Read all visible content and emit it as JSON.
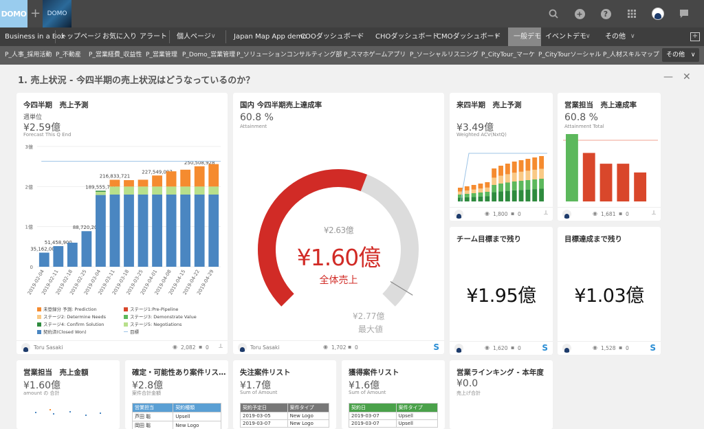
{
  "topbar": {
    "logo": "DOMO",
    "plus": "+",
    "logo2": "DOMO"
  },
  "nav1": {
    "items": [
      "Business in a Box",
      "トップページ",
      "お気に入り",
      "アラート",
      "個人ページ",
      "Japan Map App demo",
      "COOダッシュボード",
      "CHOダッシュボード",
      "CMOダッシュボード",
      "一般デモ",
      "イベントデモ",
      "その他"
    ]
  },
  "nav2": {
    "items": [
      "P_人事_採用活動",
      "P_不動産",
      "P_営業経費_収益性",
      "P_営業管理",
      "P_Domo_営業管理",
      "P_ソリューションコンサルティング部",
      "P_スマホゲームアプリ",
      "P_ソーシャルリスニング",
      "P_CityTour_マーケ",
      "P_CityTourソーシャル",
      "P_人材スキルマップ"
    ],
    "more": "その他"
  },
  "page": {
    "title": "1. 売上状況 - 今四半期の売上状況はどうなっているのか？",
    "minimize": "—",
    "close": "✕"
  },
  "colors": {
    "prediction": "#f58b2f",
    "pre_pipeline": "#d9472b",
    "determine": "#f9c985",
    "demonstrate": "#5cb85c",
    "confirm": "#2e8b3e",
    "negotiations": "#b8e08c",
    "closed": "#4a86c1",
    "target": "#9cc3e6",
    "gauge_fill": "#d12b26",
    "gauge_bg": "#dcdcdc",
    "salesforce": "#2a8dd4"
  },
  "forecast": {
    "title": "今四半期　売上予測",
    "subtitle": "週単位",
    "value": "¥2.59億",
    "caption": "Forecast This Q End",
    "footer": {
      "user": "Toru Sasaki",
      "views": "2,082",
      "comments": "0"
    },
    "legend": [
      "未登録分 予測: Prediction",
      "ステージ1:Pre-Pipeline",
      "ステージ2: Determine Needs",
      "ステージ3: Demonstrate Value",
      "ステージ4: Confirm Solution",
      "ステージ5: Negotiations",
      "契約済(Closed Won)",
      "目標"
    ]
  },
  "chart_data": {
    "type": "bar",
    "stacked": true,
    "categories": [
      "2019-02-04",
      "2019-02-11",
      "2019-02-18",
      "2019-02-25",
      "2019-03-04",
      "2019-03-11",
      "2019-03-18",
      "2019-03-25",
      "2019-04-01",
      "2019-04-08",
      "2019-04-15",
      "2019-04-22",
      "2019-04-29"
    ],
    "series": [
      {
        "name": "契約済(Closed Won)",
        "values": [
          35162000,
          51458900,
          60000000,
          88720200,
          179000000,
          180000000,
          180000000,
          180000000,
          180000000,
          180000000,
          180000000,
          180000000,
          180000000
        ]
      },
      {
        "name": "ステージ5: Negotiations",
        "values": [
          0,
          0,
          0,
          0,
          8000000,
          20000000,
          20000000,
          20000000,
          20000000,
          20000000,
          20000000,
          20000000,
          20000000
        ]
      },
      {
        "name": "ステージ4: Confirm Solution",
        "values": [
          0,
          0,
          0,
          0,
          2555721,
          0,
          0,
          0,
          0,
          0,
          0,
          0,
          0
        ]
      },
      {
        "name": "ステージ3: Demonstrate Value",
        "values": [
          0,
          0,
          0,
          0,
          0,
          0,
          0,
          0,
          0,
          0,
          0,
          0,
          0
        ]
      },
      {
        "name": "ステージ2: Determine Needs",
        "values": [
          0,
          0,
          0,
          0,
          0,
          0,
          0,
          0,
          0,
          0,
          0,
          0,
          0
        ]
      },
      {
        "name": "ステージ1:Pre-Pipeline",
        "values": [
          0,
          0,
          0,
          0,
          0,
          0,
          0,
          0,
          0,
          0,
          0,
          0,
          0
        ]
      },
      {
        "name": "未登録分 予測: Prediction",
        "values": [
          0,
          0,
          0,
          0,
          0,
          16833721,
          16000000,
          17000000,
          27549097,
          38000000,
          42000000,
          50508928,
          56000000
        ]
      }
    ],
    "target": {
      "name": "目標",
      "value": 263000000
    },
    "data_labels": [
      "35,162,000",
      "51,458,900",
      "",
      "88,720,200",
      "189,555,721",
      "216,833,721",
      "",
      "",
      "227,549,097",
      "",
      "",
      "250,508,928",
      ""
    ],
    "y_ticks": [
      "0",
      "1億",
      "2億",
      "3億"
    ],
    "ylim": [
      0,
      300000000
    ]
  },
  "gauge": {
    "title": "国内 今四半期売上達成率",
    "value": "60.8 %",
    "caption": "Attainment",
    "target_label": "¥2.63億",
    "center_value": "¥1.60億",
    "center_label": "全体売上",
    "max_value": "¥2.77億",
    "max_label": "最大値",
    "fraction": 0.578,
    "target_fraction": 0.95,
    "footer": {
      "user": "Toru Sasaki",
      "views": "1,702",
      "comments": "0"
    }
  },
  "next_q": {
    "title": "来四半期　売上予測",
    "value": "¥3.49億",
    "caption": "Weighted ACV(NxtQ)",
    "footer": {
      "views": "1,800",
      "comments": "0"
    }
  },
  "rep_attain": {
    "title": "営業担当　売上達成率",
    "value": "60.8 %",
    "caption": "Attainment Total",
    "bars": [
      100,
      72,
      56,
      56,
      43
    ],
    "footer": {
      "views": "1,681",
      "comments": "0"
    }
  },
  "team_remain": {
    "title": "チーム目標まで残り",
    "value": "¥1.95億",
    "footer": {
      "views": "1,620",
      "comments": "0"
    }
  },
  "target_remain": {
    "title": "目標達成まで残り",
    "value": "¥1.03億",
    "footer": {
      "views": "1,528",
      "comments": "0"
    }
  },
  "rep_sales": {
    "title": "営業担当　売上金額",
    "value": "¥1.60億",
    "caption": "amount の 合計"
  },
  "deals": {
    "title": "確定・可能性あり案件リス…",
    "value": "¥2.8億",
    "caption": "案件合計金額",
    "headers": [
      "営業担当",
      "契約種類"
    ],
    "rows": [
      [
        "芦田 聡",
        "Upsell"
      ],
      [
        "岡田 聡",
        "New Logo"
      ]
    ]
  },
  "lost": {
    "title": "失注案件リスト",
    "value": "¥1.7億",
    "caption": "Sum of Amount",
    "headers": [
      "契約予定日",
      "案件タイプ"
    ],
    "rows": [
      [
        "2019-03-05",
        "New Logo"
      ],
      [
        "2019-03-07",
        "New Logo"
      ]
    ]
  },
  "won": {
    "title": "獲得案件リスト",
    "value": "¥1.6億",
    "caption": "Sum of Amount",
    "headers": [
      "契約日",
      "案件タイプ"
    ],
    "rows": [
      [
        "2019-03-07",
        "Upsell"
      ],
      [
        "2019-03-07",
        "Upsell"
      ]
    ]
  },
  "ranking": {
    "title": "営業ラインキング - 本年度",
    "value": "¥0.0",
    "caption": "売上げ合計"
  }
}
